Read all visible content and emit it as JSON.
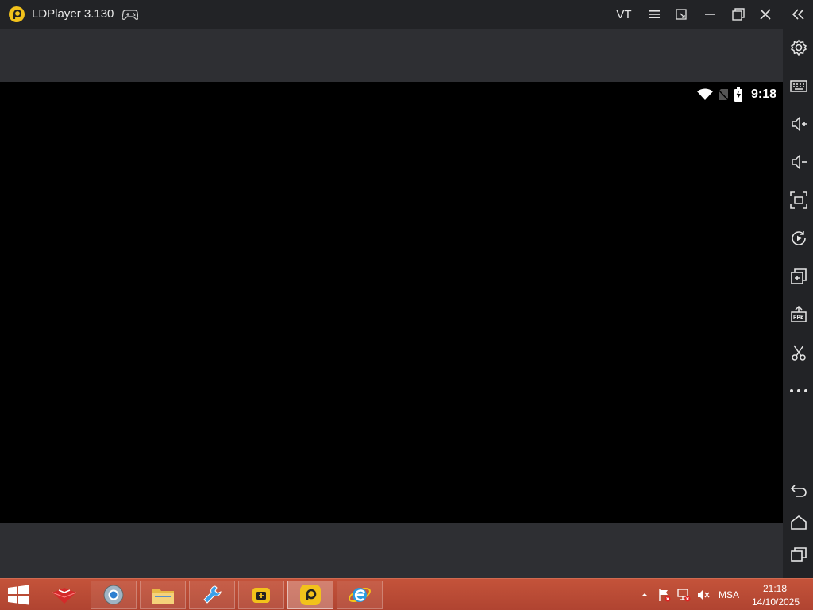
{
  "window": {
    "title": "LDPlayer 3.130",
    "vt_label": "VT"
  },
  "android_status": {
    "time": "9:18"
  },
  "sidebar": {
    "items": [
      {
        "name": "settings",
        "icon": "gear-icon"
      },
      {
        "name": "keyboard",
        "icon": "keyboard-icon"
      },
      {
        "name": "volume-up",
        "icon": "volume-up-icon"
      },
      {
        "name": "volume-down",
        "icon": "volume-down-icon"
      },
      {
        "name": "fullscreen",
        "icon": "fullscreen-icon"
      },
      {
        "name": "record",
        "icon": "record-icon"
      },
      {
        "name": "multi-instance",
        "icon": "add-window-icon"
      },
      {
        "name": "install-apk",
        "icon": "apk-icon"
      },
      {
        "name": "screenshot",
        "icon": "scissors-icon"
      },
      {
        "name": "more",
        "icon": "more-icon"
      }
    ],
    "nav": [
      {
        "name": "back",
        "icon": "back-icon"
      },
      {
        "name": "home",
        "icon": "home-icon"
      },
      {
        "name": "recents",
        "icon": "recents-icon"
      }
    ]
  },
  "taskbar": {
    "apps": [
      {
        "name": "red-app",
        "icon": "red-box-icon"
      },
      {
        "name": "chrome",
        "icon": "chrome-icon"
      },
      {
        "name": "file-explorer",
        "icon": "folder-icon"
      },
      {
        "name": "tool-app",
        "icon": "wrench-icon"
      },
      {
        "name": "ld-store",
        "icon": "ld-store-icon"
      },
      {
        "name": "ldplayer",
        "icon": "ldplayer-icon"
      },
      {
        "name": "internet-explorer",
        "icon": "ie-icon"
      }
    ],
    "language": "MSA",
    "clock_time": "21:18",
    "clock_date": "14/10/2025"
  },
  "colors": {
    "titlebar": "#222326",
    "sidebar": "#222326",
    "screen_letterbox": "#2e2f33",
    "taskbar": "#b84a35",
    "ld_yellow": "#f2c21b"
  }
}
